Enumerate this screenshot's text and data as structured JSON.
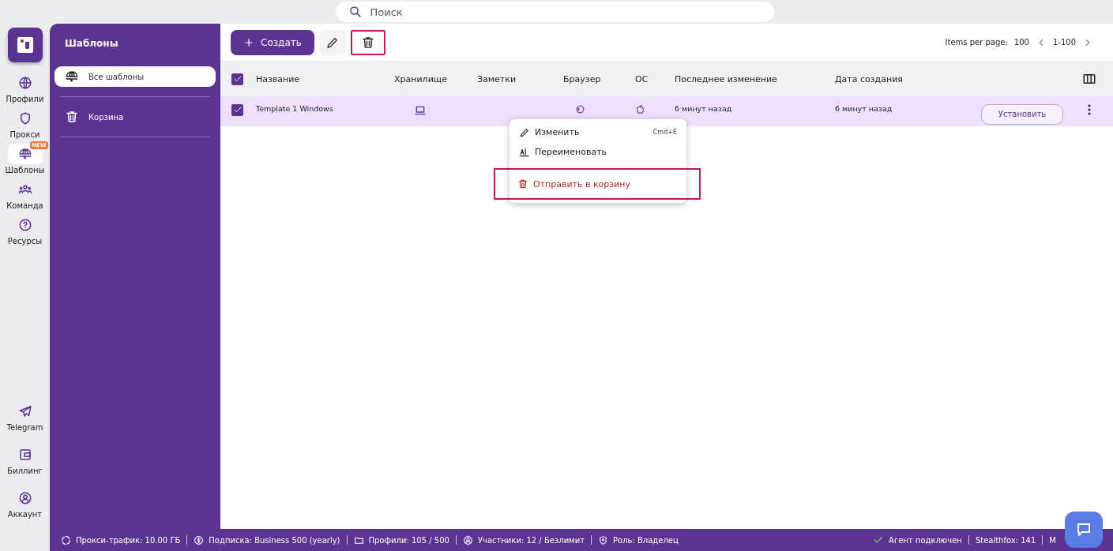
{
  "search": {
    "placeholder": "Поиск"
  },
  "nav": {
    "items": [
      {
        "label": "Профили",
        "selected": false
      },
      {
        "label": "Прокси",
        "selected": false
      },
      {
        "label": "Шаблоны",
        "selected": true,
        "badge": "NEW"
      },
      {
        "label": "Команда",
        "selected": false
      },
      {
        "label": "Ресурсы",
        "selected": false
      }
    ],
    "bottom_items": [
      {
        "label": "Telegram"
      },
      {
        "label": "Биллинг"
      },
      {
        "label": "Аккаунт"
      }
    ]
  },
  "sidebar": {
    "title": "Шаблоны",
    "items": [
      {
        "label": "Все шаблоны",
        "selected": true
      },
      {
        "label": "Корзина",
        "selected": false
      }
    ]
  },
  "toolbar": {
    "create_button": "Создать",
    "delete_highlighted": true,
    "pagination": {
      "label": "Items per page:",
      "per_page": "100",
      "range": "1-100"
    }
  },
  "table": {
    "all_checked": true,
    "columns": [
      "Название",
      "Хранилище",
      "Заметки",
      "Браузер",
      "ОС",
      "Последнее изменение",
      "Дата создания"
    ],
    "rows": [
      {
        "checked": true,
        "selected": true,
        "name": "Template 1 Windows",
        "last_modified": "6 минут назад",
        "created": "6 минут назад",
        "action": "Установить"
      }
    ]
  },
  "context_menu": {
    "items": [
      {
        "label": "Изменить",
        "shortcut": "Cmd+E",
        "danger": false,
        "highlighted": false
      },
      {
        "label": "Переименовать",
        "danger": false,
        "highlighted": false
      },
      {
        "label": "Отправить в корзину",
        "danger": true,
        "highlighted": true
      }
    ]
  },
  "status_bar": {
    "left": [
      "Прокси-трафик: 10.00 ГБ",
      "Подписка: Business 500 (yearly)",
      "Профили: 105 / 500",
      "Участники: 12 / Безлимит",
      "Роль: Владелец"
    ],
    "right": [
      {
        "text": "Агент подключен",
        "connected": true
      },
      {
        "text": "Stealthfox: 141",
        "connected": false
      },
      {
        "text": "M",
        "connected": false
      }
    ]
  }
}
